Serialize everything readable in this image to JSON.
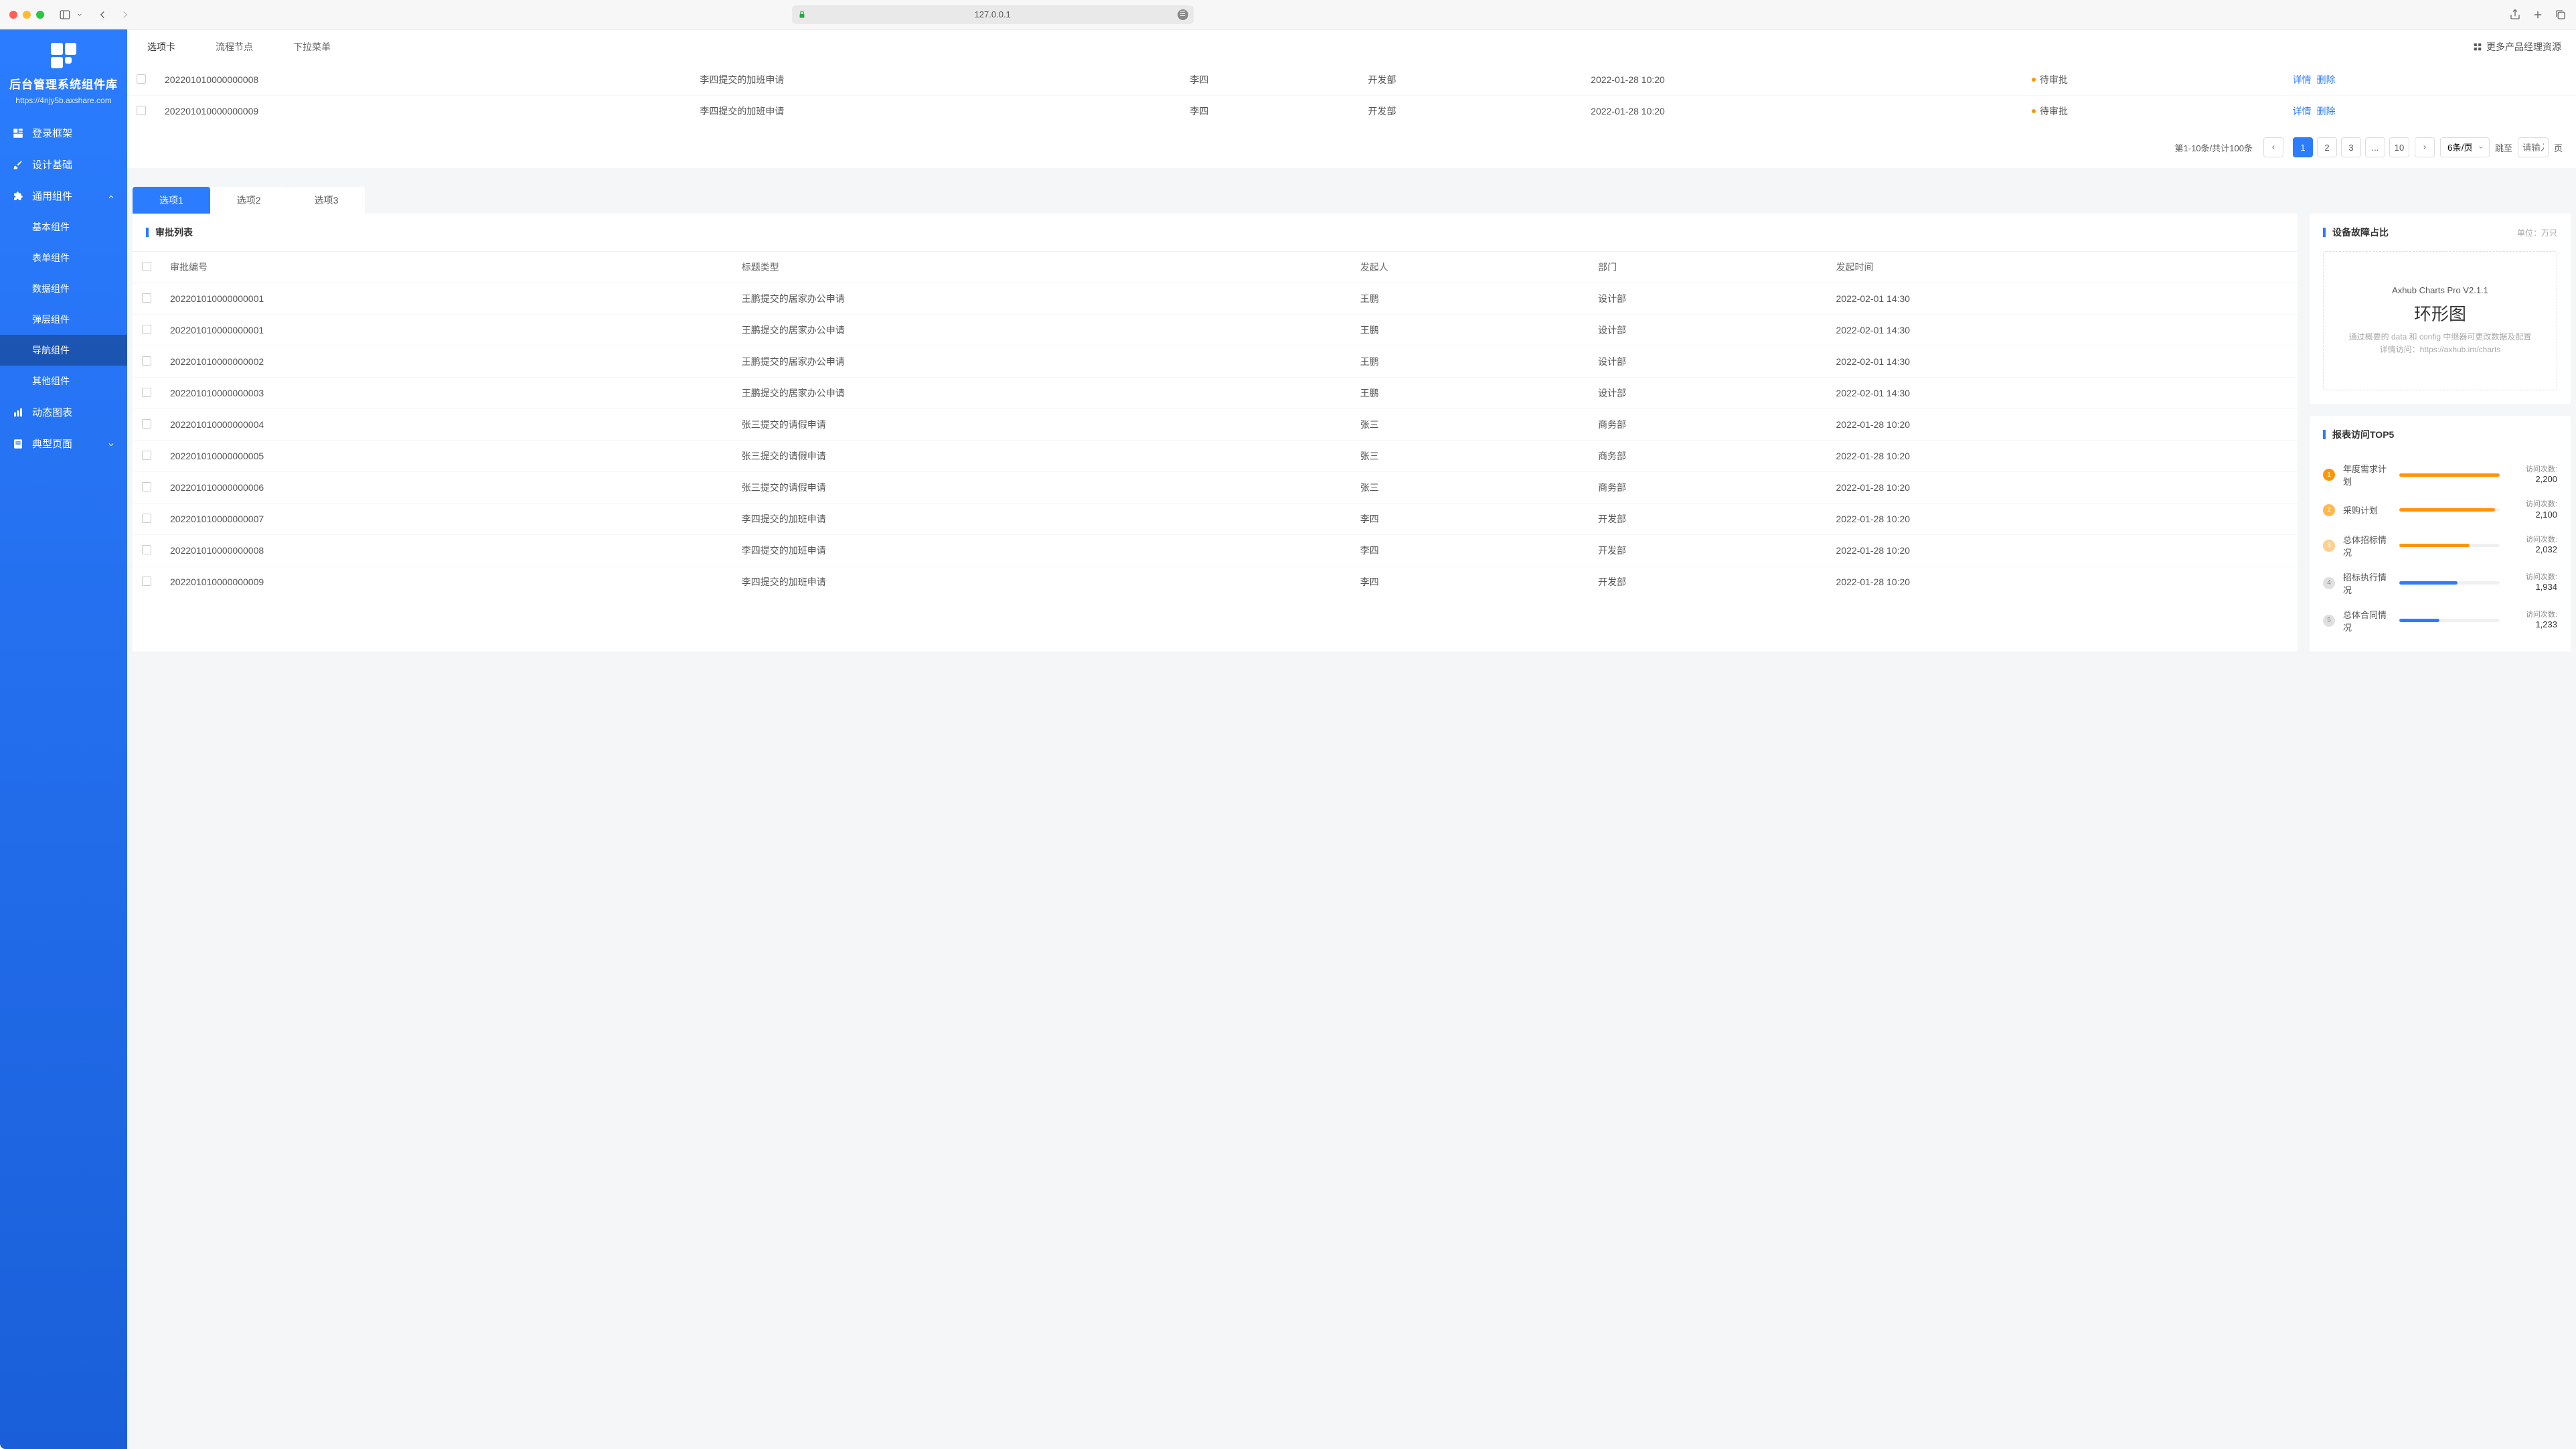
{
  "browser": {
    "url": "127.0.0.1"
  },
  "sidebar": {
    "logo_title": "后台管理系统组件库",
    "logo_url": "https://4njy5b.axshare.com",
    "nav": [
      {
        "label": "登录框架",
        "icon": "layout-icon"
      },
      {
        "label": "设计基础",
        "icon": "brush-icon"
      },
      {
        "label": "通用组件",
        "icon": "puzzle-icon",
        "expanded": true,
        "children": [
          {
            "label": "基本组件"
          },
          {
            "label": "表单组件"
          },
          {
            "label": "数据组件"
          },
          {
            "label": "弹层组件"
          },
          {
            "label": "导航组件",
            "active": true
          },
          {
            "label": "其他组件"
          }
        ]
      },
      {
        "label": "动态图表",
        "icon": "chart-icon"
      },
      {
        "label": "典型页面",
        "icon": "page-icon",
        "collapsible": true
      }
    ]
  },
  "top_tabs": {
    "items": [
      "选项卡",
      "流程节点",
      "下拉菜单"
    ],
    "more": "更多产品经理资源"
  },
  "top_table": {
    "rows": [
      {
        "id": "202201010000000008",
        "title": "李四提交的加班申请",
        "owner": "李四",
        "dept": "开发部",
        "time": "2022-01-28 10:20",
        "status": "待审批",
        "actions": [
          "详情",
          "删除"
        ]
      },
      {
        "id": "202201010000000009",
        "title": "李四提交的加班申请",
        "owner": "李四",
        "dept": "开发部",
        "time": "2022-01-28 10:20",
        "status": "待审批",
        "actions": [
          "详情",
          "删除"
        ]
      }
    ]
  },
  "pagination": {
    "summary": "第1-10条/共计100条",
    "pages": [
      "1",
      "2",
      "3",
      "...",
      "10"
    ],
    "per_page": "6条/页",
    "jump_label": "跳至",
    "jump_suffix": "页",
    "jump_placeholder": "请输入"
  },
  "sub_tabs": {
    "items": [
      "选项1",
      "选项2",
      "选项3"
    ]
  },
  "list_card": {
    "title": "审批列表",
    "columns": [
      "审批编号",
      "标题类型",
      "发起人",
      "部门",
      "发起时间"
    ],
    "rows": [
      {
        "id": "202201010000000001",
        "title": "王鹏提交的居家办公申请",
        "owner": "王鹏",
        "dept": "设计部",
        "time": "2022-02-01  14:30"
      },
      {
        "id": "202201010000000001",
        "title": "王鹏提交的居家办公申请",
        "owner": "王鹏",
        "dept": "设计部",
        "time": "2022-02-01  14:30"
      },
      {
        "id": "202201010000000002",
        "title": "王鹏提交的居家办公申请",
        "owner": "王鹏",
        "dept": "设计部",
        "time": "2022-02-01  14:30"
      },
      {
        "id": "202201010000000003",
        "title": "王鹏提交的居家办公申请",
        "owner": "王鹏",
        "dept": "设计部",
        "time": "2022-02-01  14:30"
      },
      {
        "id": "202201010000000004",
        "title": "张三提交的请假申请",
        "owner": "张三",
        "dept": "商务部",
        "time": "2022-01-28  10:20"
      },
      {
        "id": "202201010000000005",
        "title": "张三提交的请假申请",
        "owner": "张三",
        "dept": "商务部",
        "time": "2022-01-28  10:20"
      },
      {
        "id": "202201010000000006",
        "title": "张三提交的请假申请",
        "owner": "张三",
        "dept": "商务部",
        "time": "2022-01-28  10:20"
      },
      {
        "id": "202201010000000007",
        "title": "李四提交的加班申请",
        "owner": "李四",
        "dept": "开发部",
        "time": "2022-01-28  10:20"
      },
      {
        "id": "202201010000000008",
        "title": "李四提交的加班申请",
        "owner": "李四",
        "dept": "开发部",
        "time": "2022-01-28  10:20"
      },
      {
        "id": "202201010000000009",
        "title": "李四提交的加班申请",
        "owner": "李四",
        "dept": "开发部",
        "time": "2022-01-28  10:20"
      }
    ]
  },
  "donut_card": {
    "title": "设备故障占比",
    "unit": "单位：万只",
    "brand": "Axhub Charts Pro V2.1.1",
    "big": "环形图",
    "desc1": "通过概要的 data 和 config 中继器可更改数据及配置",
    "desc2": "详情访问：https://axhub.im/charts"
  },
  "rank_card": {
    "title": "报表访问TOP5",
    "label_visits": "访问次数:",
    "items": [
      {
        "rank": 1,
        "name": "年度需求计划",
        "count": "2,200",
        "pct": 100
      },
      {
        "rank": 2,
        "name": "采购计划",
        "count": "2,100",
        "pct": 95
      },
      {
        "rank": 3,
        "name": "总体招标情况",
        "count": "2,032",
        "pct": 70
      },
      {
        "rank": 4,
        "name": "招标执行情况",
        "count": "1,934",
        "pct": 58
      },
      {
        "rank": 5,
        "name": "总体合同情况",
        "count": "1,233",
        "pct": 40
      }
    ]
  },
  "chart_data": {
    "type": "bar",
    "title": "报表访问TOP5",
    "xlabel": "",
    "ylabel": "访问次数",
    "categories": [
      "年度需求计划",
      "采购计划",
      "总体招标情况",
      "招标执行情况",
      "总体合同情况"
    ],
    "values": [
      2200,
      2100,
      2032,
      1934,
      1233
    ]
  }
}
